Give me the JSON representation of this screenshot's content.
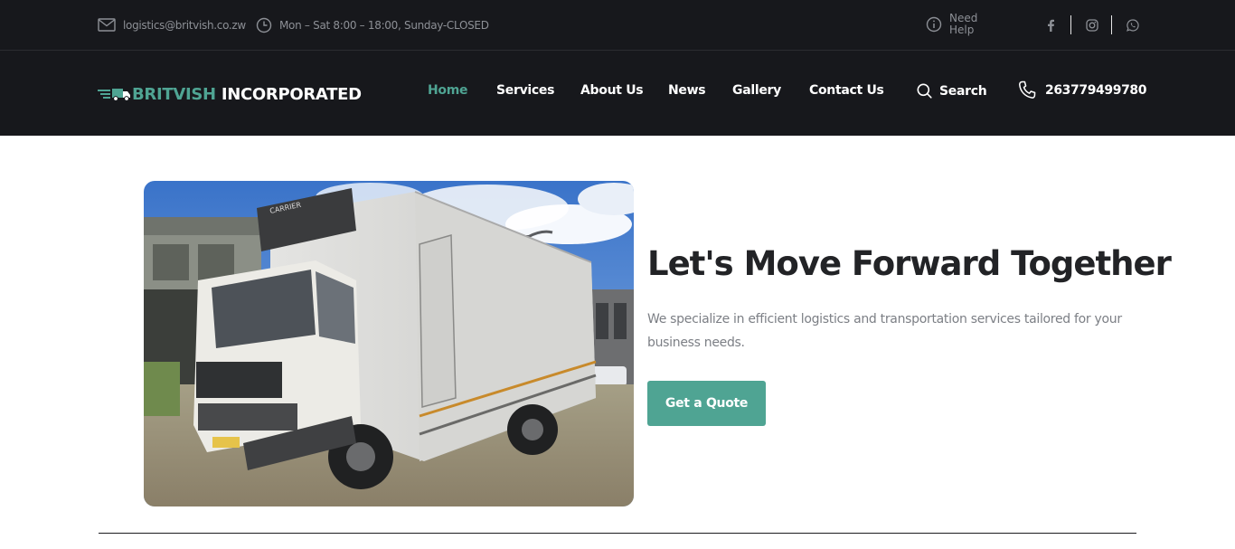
{
  "topbar": {
    "email": "logistics@britvish.co.zw",
    "hours": "Mon – Sat 8:00 – 18:00, Sunday-CLOSED",
    "need_help_line1": "Need",
    "need_help_line2": "Help",
    "social_icons": [
      "facebook-icon",
      "instagram-icon",
      "whatsapp-icon"
    ]
  },
  "header": {
    "logo_word1": "BRITVISH",
    "logo_word2": "INCORPORATED",
    "nav": [
      {
        "label": "Home",
        "active": true
      },
      {
        "label": "Services",
        "active": false
      },
      {
        "label": "About Us",
        "active": false
      },
      {
        "label": "News",
        "active": false
      },
      {
        "label": "Gallery",
        "active": false
      },
      {
        "label": "Contact Us",
        "active": false
      }
    ],
    "search_label": "Search",
    "phone": "263779499780"
  },
  "hero": {
    "title": "Let's Move Forward Together",
    "description": "We specialize in efficient logistics and transportation services tailored for your business needs.",
    "cta_label": "Get a Quote",
    "truck_cab_label": "CARRIER"
  },
  "colors": {
    "accent": "#4fa493",
    "dark_bg": "#17181c",
    "title": "#222326",
    "body_text": "#7c7f85"
  }
}
